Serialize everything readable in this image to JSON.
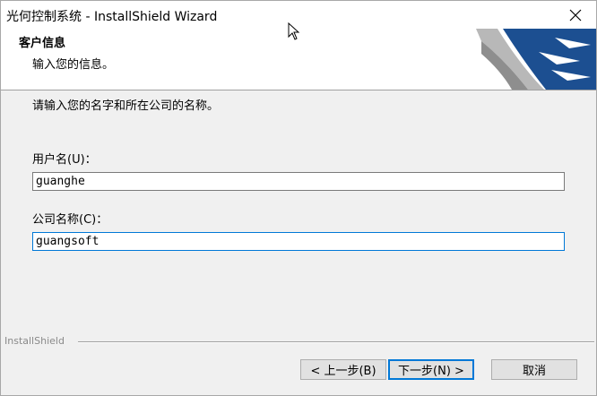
{
  "window": {
    "title": "光何控制系统 - InstallShield Wizard"
  },
  "header": {
    "title": "客户信息",
    "subtitle": "输入您的信息。"
  },
  "content": {
    "instruction": "请输入您的名字和所在公司的名称。",
    "user_name_label": "用户名(U)：",
    "user_name_value": "guanghe",
    "company_label": "公司名称(C)：",
    "company_value": "guangsoft"
  },
  "footer": {
    "brand": "InstallShield",
    "back_label": "< 上一步(B)",
    "next_label": "下一步(N) >",
    "cancel_label": "取消"
  },
  "colors": {
    "logo_blue": "#1c4f91",
    "focus_border": "#0078d7"
  },
  "icons": {
    "close": "close-icon",
    "logo": "installshield-logo",
    "cursor": "mouse-cursor-icon"
  }
}
